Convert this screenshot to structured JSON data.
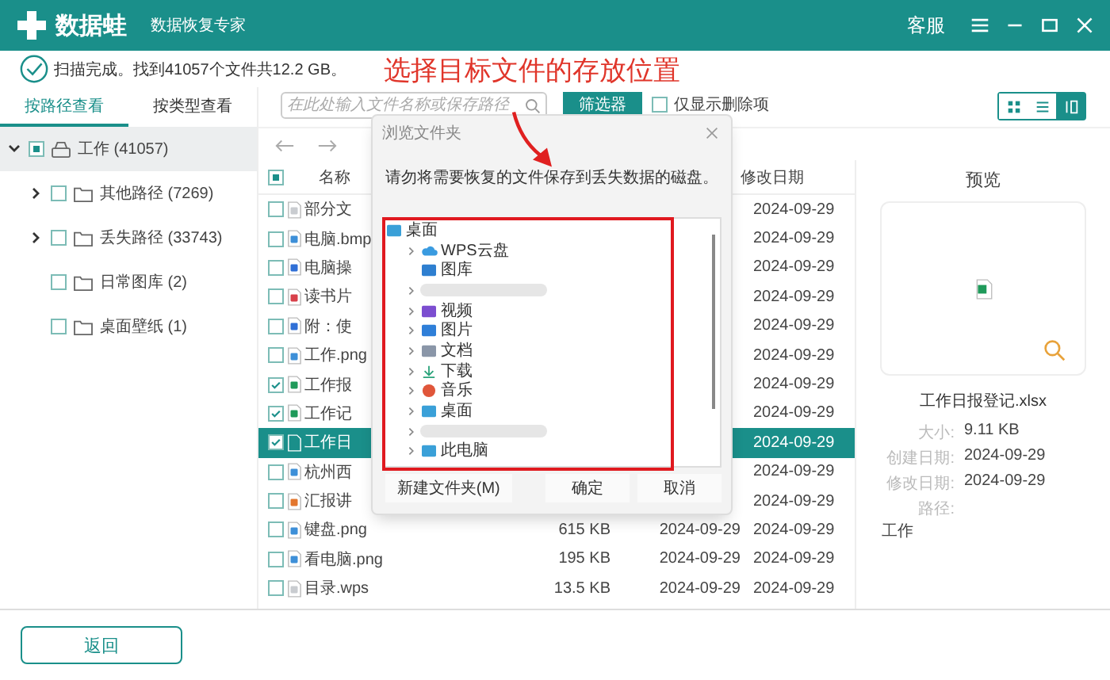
{
  "app": {
    "name": "数据蛙",
    "subtitle": "数据恢复专家",
    "service": "客服"
  },
  "status": "扫描完成。找到41057个文件共12.2 GB。",
  "annotation": "选择目标文件的存放位置",
  "view_tabs": [
    {
      "label": "按路径查看",
      "selected": true
    },
    {
      "label": "按类型查看",
      "selected": false
    }
  ],
  "tree": [
    {
      "label": "工作 (41057)",
      "kind": "drive",
      "partial": true,
      "expanded": true,
      "selected": true,
      "children": [
        {
          "label": "其他路径 (7269)",
          "kind": "folder",
          "checked": false,
          "expandable": true
        },
        {
          "label": "丢失路径 (33743)",
          "kind": "folder",
          "checked": false,
          "expandable": true
        },
        {
          "label": "日常图库 (2)",
          "kind": "folder",
          "checked": false,
          "expandable": false
        },
        {
          "label": "桌面壁纸 (1)",
          "kind": "folder",
          "checked": false,
          "expandable": false
        }
      ]
    }
  ],
  "search": {
    "placeholder": "在此处输入文件名称或保存路径"
  },
  "filter_button": "筛选器",
  "deleted_only": {
    "label": "仅显示删除项",
    "checked": false
  },
  "view_modes": [
    {
      "kind": "grid",
      "selected": false
    },
    {
      "kind": "list",
      "selected": false
    },
    {
      "kind": "detail",
      "selected": true
    }
  ],
  "table": {
    "header_checkbox": {
      "partial": true
    },
    "columns": [
      "名称",
      "修改日期"
    ],
    "rows": [
      {
        "kind": "text",
        "name": "部分文",
        "modified": "2024-09-29",
        "checked": false,
        "selected": false
      },
      {
        "kind": "image",
        "name": "电脑.bmp",
        "modified": "2024-09-29",
        "checked": false,
        "selected": false
      },
      {
        "kind": "doc",
        "name": "电脑操",
        "modified": "2024-09-29",
        "checked": false,
        "selected": false
      },
      {
        "kind": "pdf",
        "name": "读书片",
        "modified": "2024-09-29",
        "checked": false,
        "selected": false
      },
      {
        "kind": "doc",
        "name": "附：使",
        "modified": "2024-09-29",
        "checked": false,
        "selected": false
      },
      {
        "kind": "image",
        "name": "工作.png",
        "modified": "2024-09-29",
        "checked": false,
        "selected": false
      },
      {
        "kind": "sheet",
        "name": "工作报",
        "modified": "2024-09-29",
        "checked": true,
        "selected": false
      },
      {
        "kind": "sheet",
        "name": "工作记",
        "modified": "2024-09-29",
        "checked": true,
        "selected": false
      },
      {
        "kind": "sheet",
        "name": "工作日",
        "modified": "2024-09-29",
        "checked": true,
        "selected": true
      },
      {
        "kind": "image",
        "name": "杭州西",
        "modified": "2024-09-29",
        "checked": false,
        "selected": false
      },
      {
        "kind": "slides",
        "name": "汇报讲",
        "modified": "2024-09-29",
        "checked": false,
        "selected": false
      },
      {
        "kind": "image",
        "name": "键盘.png",
        "size": "615 KB",
        "created": "2024-09-29",
        "modified": "2024-09-29",
        "checked": false,
        "selected": false
      },
      {
        "kind": "image",
        "name": "看电脑.png",
        "size": "195 KB",
        "created": "2024-09-29",
        "modified": "2024-09-29",
        "checked": false,
        "selected": false
      },
      {
        "kind": "text",
        "name": "目录.wps",
        "size": "13.5 KB",
        "created": "2024-09-29",
        "modified": "2024-09-29",
        "checked": false,
        "selected": false
      }
    ]
  },
  "preview": {
    "title": "预览",
    "file_name": "工作日报登记.xlsx",
    "details": [
      {
        "label": "大小:",
        "value": "9.11 KB"
      },
      {
        "label": "创建日期:",
        "value": "2024-09-29"
      },
      {
        "label": "修改日期:",
        "value": "2024-09-29"
      },
      {
        "label": "路径:"
      }
    ],
    "path": "工作"
  },
  "dialog": {
    "title": "浏览文件夹",
    "message": "请勿将需要恢复的文件保存到丢失数据的磁盘。",
    "root": {
      "label": "桌面",
      "kind": "desktop",
      "children": [
        {
          "label": "WPS云盘",
          "kind": "cloud",
          "expandable": true
        },
        {
          "label": "图库",
          "kind": "gallery",
          "expandable": false
        },
        {
          "kind": "blurred",
          "expandable": true
        },
        {
          "label": "视频",
          "kind": "video",
          "expandable": true
        },
        {
          "label": "图片",
          "kind": "pictures",
          "expandable": true
        },
        {
          "label": "文档",
          "kind": "documents",
          "expandable": true
        },
        {
          "label": "下载",
          "kind": "downloads",
          "expandable": true
        },
        {
          "label": "音乐",
          "kind": "music",
          "expandable": true
        },
        {
          "label": "桌面",
          "kind": "desktop",
          "expandable": true
        },
        {
          "kind": "blurred",
          "expandable": true
        },
        {
          "label": "此电脑",
          "kind": "computer",
          "expandable": true
        }
      ]
    },
    "buttons": [
      "新建文件夹(M)",
      "确定",
      "取消"
    ]
  },
  "back_button": "返回"
}
